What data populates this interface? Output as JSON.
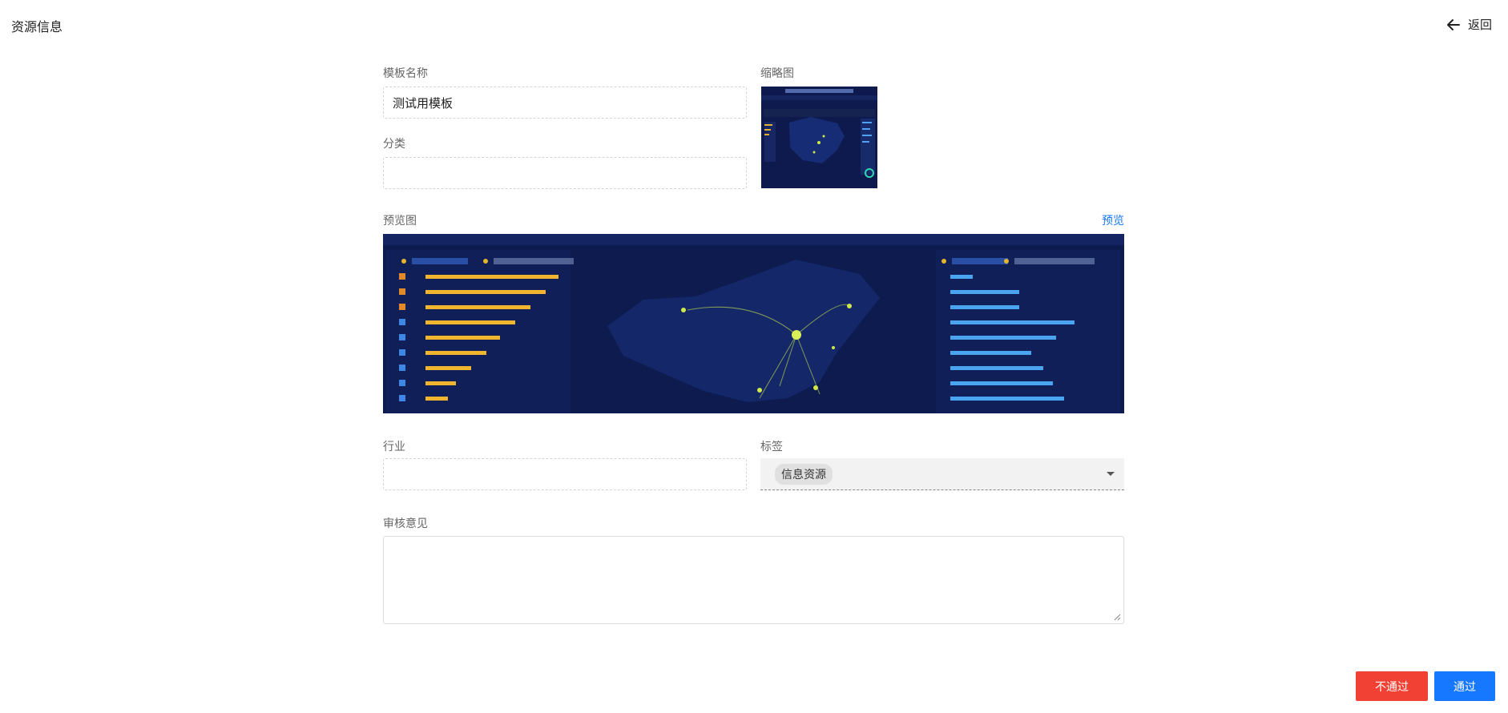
{
  "header": {
    "title": "资源信息",
    "back_label": "返回"
  },
  "form": {
    "template_name": {
      "label": "模板名称",
      "value": "测试用模板"
    },
    "thumbnail": {
      "label": "缩略图"
    },
    "category": {
      "label": "分类",
      "value": ""
    },
    "preview": {
      "label": "预览图",
      "link_label": "预览"
    },
    "industry": {
      "label": "行业",
      "value": ""
    },
    "tags": {
      "label": "标签",
      "selected": [
        "信息资源"
      ]
    },
    "review": {
      "label": "审核意见",
      "value": ""
    }
  },
  "actions": {
    "reject_label": "不通过",
    "approve_label": "通过"
  },
  "colors": {
    "primary": "#1677ff",
    "danger": "#f04134",
    "dashboard_bg": "#0d1b4f"
  }
}
